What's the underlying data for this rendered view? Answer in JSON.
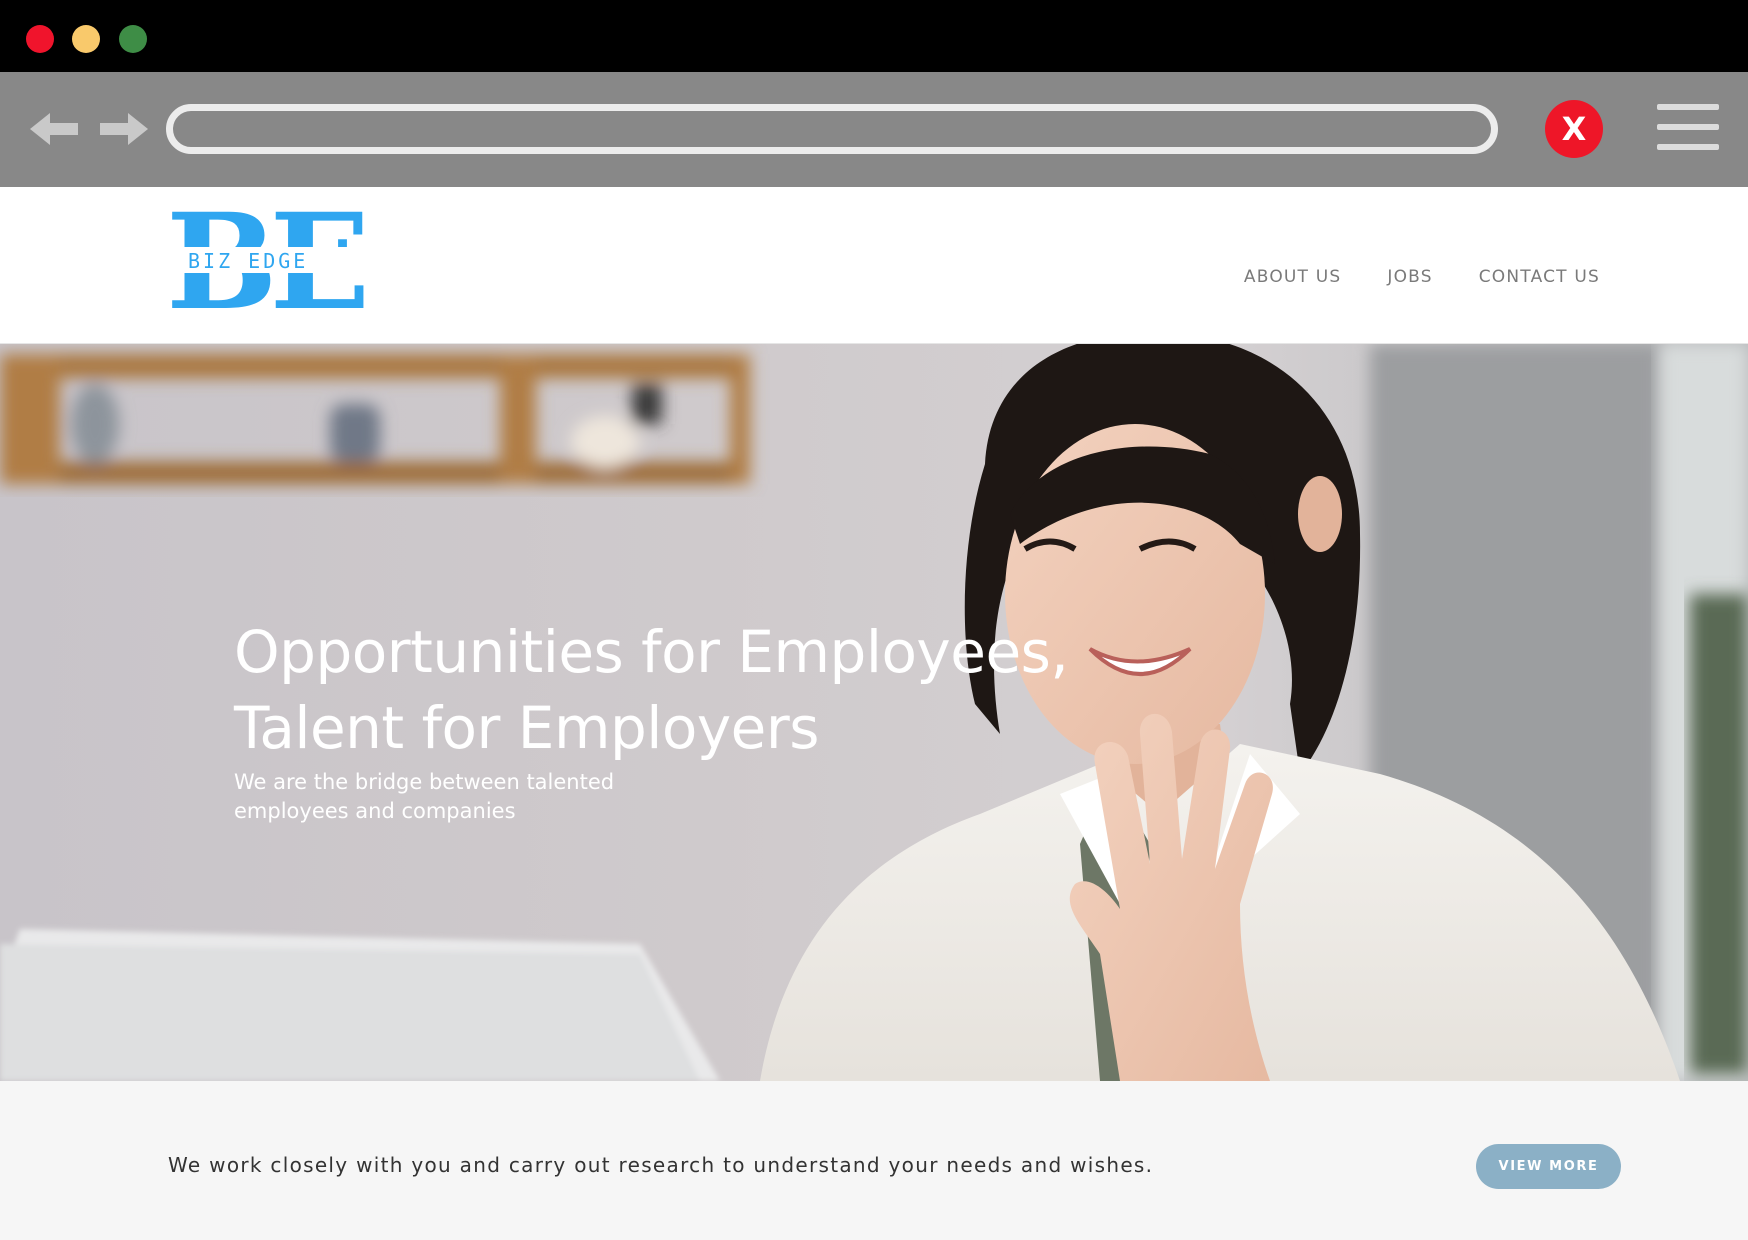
{
  "window": {
    "controls": [
      "close-dot",
      "minimize-dot",
      "maximize-dot"
    ]
  },
  "browser": {
    "back_icon": "arrow-left-icon",
    "forward_icon": "arrow-right-icon",
    "stop_label": "X",
    "menu_icon": "hamburger-menu-icon"
  },
  "header": {
    "logo": {
      "letters": "BE",
      "subtitle": "BIZ EDGE",
      "color": "#2fa6f0"
    },
    "nav": [
      "ABOUT US",
      "JOBS",
      "CONTACT US"
    ]
  },
  "hero": {
    "title_line1": "Opportunities for Employees,",
    "title_line2": "Talent for Employers",
    "subtitle_line1": "We are the bridge between talented",
    "subtitle_line2": "employees and companies"
  },
  "strip": {
    "text": "We work closely with you and carry out research to understand your needs and wishes.",
    "button": "VIEW MORE",
    "button_color": "#8bb0c6"
  }
}
